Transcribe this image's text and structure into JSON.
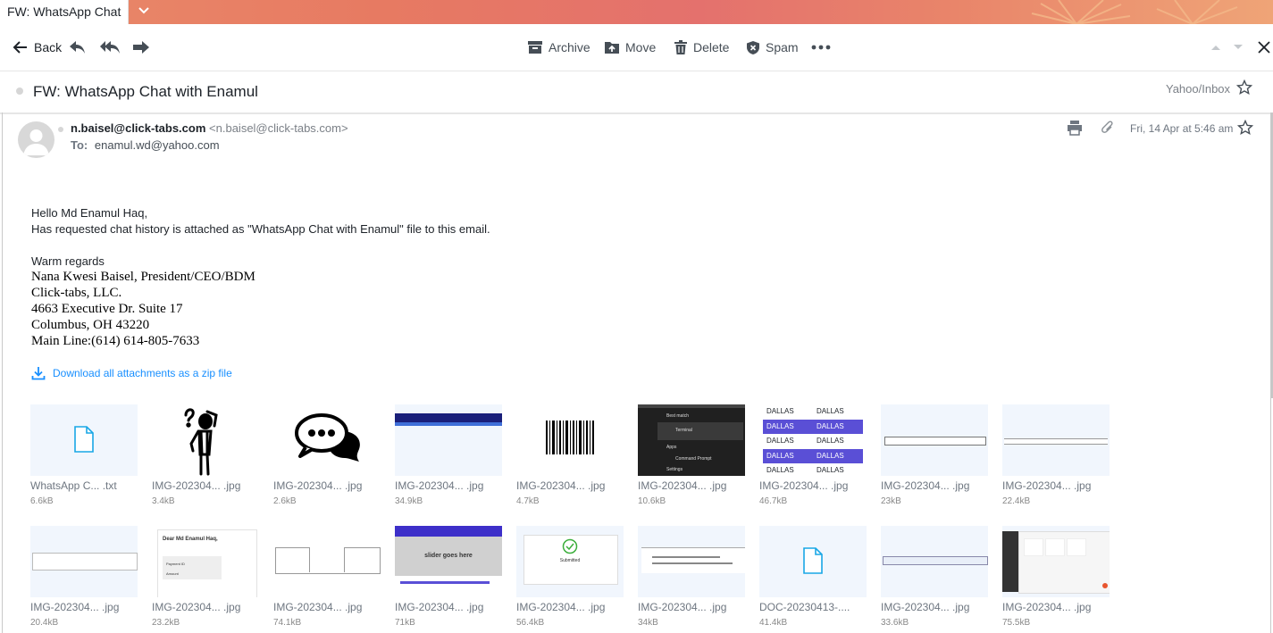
{
  "tab": {
    "title": "FW: WhatsApp Chat with Enamul"
  },
  "toolbar": {
    "back_label": "Back",
    "archive_label": "Archive",
    "move_label": "Move",
    "delete_label": "Delete",
    "spam_label": "Spam"
  },
  "subject": "FW: WhatsApp Chat with Enamul",
  "folder": "Yahoo/Inbox",
  "header": {
    "sender_name": "n.baisel@click-tabs.com",
    "sender_addr": "<n.baisel@click-tabs.com>",
    "to_label": "To:",
    "to_addr": "enamul.wd@yahoo.com",
    "date": "Fri, 14 Apr at 5:46 am"
  },
  "body": {
    "line1": "Hello Md Enamul Haq,",
    "line2": "Has requested chat history is attached as \"WhatsApp Chat with Enamul\" file to this email.",
    "regards": "Warm regards"
  },
  "signature": {
    "l1": "Nana Kwesi Baisel, President/CEO/BDM",
    "l2": "Click-tabs, LLC.",
    "l3": "4663 Executive Dr. Suite 17",
    "l4": "Columbus, OH 43220",
    "l5": "Main Line:(614) 614-805-7633"
  },
  "download_label": "Download all attachments as a zip file",
  "attachments": [
    {
      "name": "WhatsApp C... .txt",
      "size": "6.6kB"
    },
    {
      "name": "IMG-202304... .jpg",
      "size": "3.4kB"
    },
    {
      "name": "IMG-202304... .jpg",
      "size": "2.6kB"
    },
    {
      "name": "IMG-202304... .jpg",
      "size": "34.9kB"
    },
    {
      "name": "IMG-202304... .jpg",
      "size": "4.7kB"
    },
    {
      "name": "IMG-202304... .jpg",
      "size": "10.6kB"
    },
    {
      "name": "IMG-202304... .jpg",
      "size": "46.7kB"
    },
    {
      "name": "IMG-202304... .jpg",
      "size": "23kB"
    },
    {
      "name": "IMG-202304... .jpg",
      "size": "22.4kB"
    },
    {
      "name": "IMG-202304... .jpg",
      "size": "20.4kB"
    },
    {
      "name": "IMG-202304... .jpg",
      "size": "23.2kB"
    },
    {
      "name": "IMG-202304... .jpg",
      "size": "74.1kB"
    },
    {
      "name": "IMG-202304... .jpg",
      "size": "71kB"
    },
    {
      "name": "IMG-202304... .jpg",
      "size": "56.4kB"
    },
    {
      "name": "IMG-202304... .jpg",
      "size": "34kB"
    },
    {
      "name": "DOC-20230413-....",
      "size": "41.4kB"
    },
    {
      "name": "IMG-202304... .jpg",
      "size": "33.6kB"
    },
    {
      "name": "IMG-202304... .jpg",
      "size": "75.5kB"
    }
  ],
  "thumb_text": {
    "dallas": "DALLAS",
    "slider": "slider goes here",
    "best_match": "Best match",
    "terminal": "Terminal",
    "apps": "Apps",
    "command_prompt": "Command Prompt",
    "settings": "Settings",
    "dear": "Dear Md Enamul Haq,",
    "payment_id": "Payment ID",
    "amount": "Amount",
    "submitted": "Submitted"
  }
}
